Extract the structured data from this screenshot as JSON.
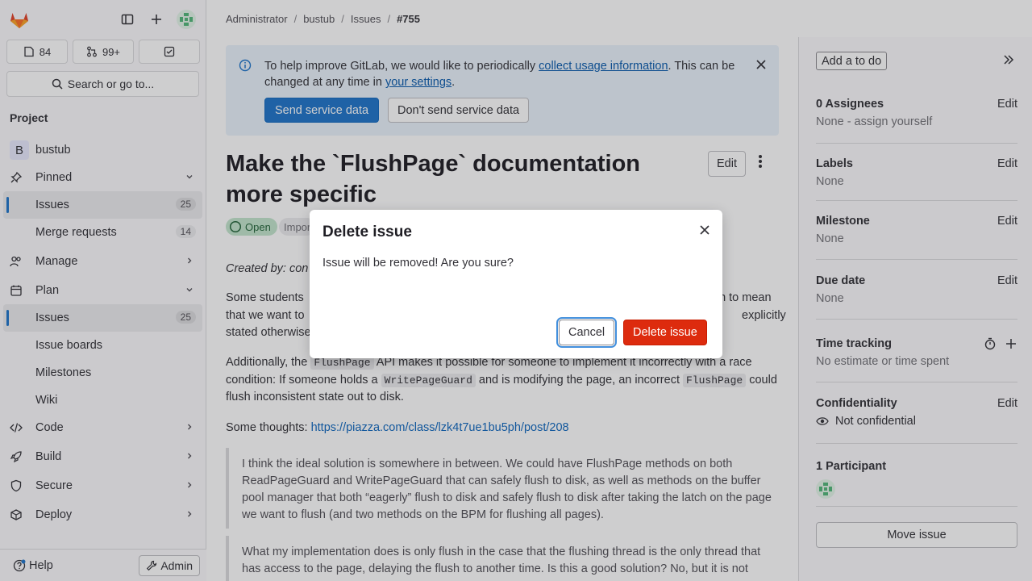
{
  "sidebar": {
    "counters": [
      {
        "icon": "issues-icon",
        "value": "84"
      },
      {
        "icon": "merge-request-icon",
        "value": "99+"
      },
      {
        "icon": "todo-icon",
        "value": ""
      }
    ],
    "search_label": "Search or go to...",
    "section": "Project",
    "project_name": "bustub",
    "project_initial": "B",
    "pinned": "Pinned",
    "pinned_items": [
      {
        "label": "Issues",
        "count": "25"
      },
      {
        "label": "Merge requests",
        "count": "14"
      }
    ],
    "manage": "Manage",
    "plan": "Plan",
    "plan_items": [
      {
        "label": "Issues",
        "count": "25"
      },
      {
        "label": "Issue boards"
      },
      {
        "label": "Milestones"
      },
      {
        "label": "Wiki"
      }
    ],
    "code": "Code",
    "build": "Build",
    "secure": "Secure",
    "deploy": "Deploy",
    "help": "Help",
    "admin": "Admin"
  },
  "breadcrumbs": [
    "Administrator",
    "bustub",
    "Issues",
    "#755"
  ],
  "alert": {
    "text_before": "To help improve GitLab, we would like to periodically ",
    "link1": "collect usage information",
    "text_mid": ". This can be changed at any time in ",
    "link2": "your settings",
    "text_end": ".",
    "send": "Send service data",
    "dont_send": "Don't send service data"
  },
  "issue": {
    "title": "Make the `FlushPage` documentation more specific",
    "edit": "Edit",
    "status": "Open",
    "badge": "Impor",
    "created": "Created by: con",
    "p1_a": "Some students",
    "p1_b": "on to mean",
    "p1_c": "that we want to",
    "p1_d": "explicitly",
    "p1_e": "stated otherwise",
    "p2_a": "Additionally, the ",
    "p2_code1": "FlushPage",
    "p2_b": " API makes it possible for someone to implement it incorrectly with a race condition: If someone holds a ",
    "p2_code2": "WritePageGuard",
    "p2_c": " and is modifying the page, an incorrect ",
    "p2_code3": "FlushPage",
    "p2_d": " could flush inconsistent state out to disk.",
    "p3_a": "Some thoughts: ",
    "p3_link": "https://piazza.com/class/lzk4t7ue1bu5ph/post/208",
    "quote1": "I think the ideal solution is somewhere in between. We could have FlushPage methods on both ReadPageGuard and WritePageGuard that can safely flush to disk, as well as methods on the buffer pool manager that both “eagerly” flush to disk and safely flush to disk after taking the latch on the page we want to flush (and two methods on the BPM for flushing all pages).",
    "quote2": "What my implementation does is only flush in the case that the flushing thread is the only thread that has access to the page, delaying the flush to another time. Is this a good solution? No, but it is not"
  },
  "right_sidebar": {
    "todo": "Add a to do",
    "assignees_title": "0 Assignees",
    "assignees_value": "None - assign yourself",
    "labels_title": "Labels",
    "labels_value": "None",
    "milestone_title": "Milestone",
    "milestone_value": "None",
    "due_title": "Due date",
    "due_value": "None",
    "time_title": "Time tracking",
    "time_value": "No estimate or time spent",
    "conf_title": "Confidentiality",
    "conf_value": "Not confidential",
    "participants_title": "1 Participant",
    "edit": "Edit",
    "move": "Move issue"
  },
  "modal": {
    "title": "Delete issue",
    "body": "Issue will be removed! Are you sure?",
    "cancel": "Cancel",
    "delete": "Delete issue"
  },
  "colors": {
    "accent": "#1f75cb",
    "danger": "#dd2b0e",
    "open_bg": "#c3e6cd"
  }
}
